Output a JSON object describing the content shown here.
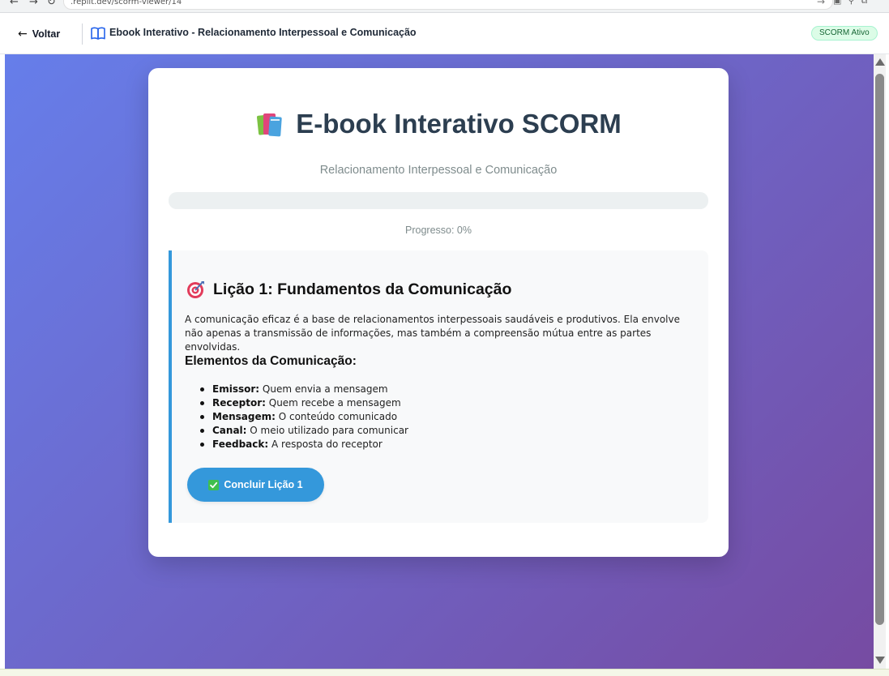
{
  "browser": {
    "url": ".replit.dev/scorm-viewer/14"
  },
  "header": {
    "back_label": "Voltar",
    "title": "Ebook Interativo - Relacionamento Interpessoal e Comunicação",
    "badge": "SCORM Ativo",
    "icons": [
      "arrow-left-icon",
      "book-open-icon"
    ]
  },
  "ebook": {
    "title": "E-book Interativo SCORM",
    "title_icon": "books-icon",
    "subtitle": "Relacionamento Interpessoal e Comunicação",
    "progress_value": 0,
    "progress_label": "Progresso: 0%"
  },
  "lesson": {
    "icon": "target-icon",
    "title": "Lição 1: Fundamentos da Comunicação",
    "text": "A comunicação eficaz é a base de relacionamentos interpessoais saudáveis e produtivos. Ela envolve não apenas a transmissão de informações, mas também a compreensão mútua entre as partes envolvidas.",
    "elements_heading": "Elementos da Comunicação:",
    "elements": [
      {
        "term": "Emissor:",
        "desc": "Quem envia a mensagem"
      },
      {
        "term": "Receptor:",
        "desc": "Quem recebe a mensagem"
      },
      {
        "term": "Mensagem:",
        "desc": "O conteúdo comunicado"
      },
      {
        "term": "Canal:",
        "desc": "O meio utilizado para comunicar"
      },
      {
        "term": "Feedback:",
        "desc": "A resposta do receptor"
      }
    ],
    "button_label": "Concluir Lição 1",
    "button_icon": "check-box-icon"
  },
  "colors": {
    "gradient_start": "#667eea",
    "gradient_end": "#764ba2",
    "accent": "#3498db",
    "badge_bg": "#dcfce7",
    "badge_text": "#166534",
    "title_text": "#2c3e50"
  }
}
